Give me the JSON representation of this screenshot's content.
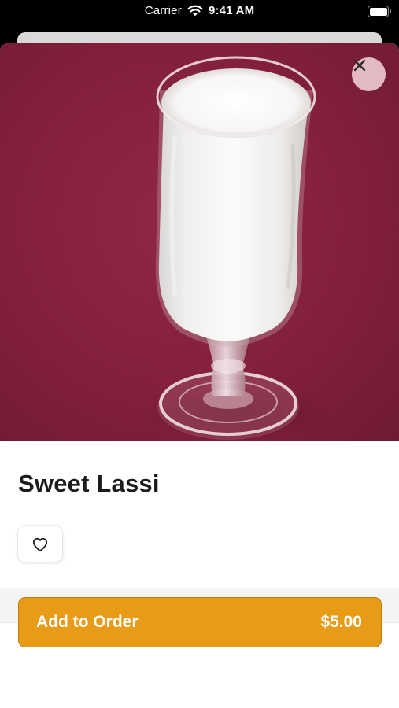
{
  "status_bar": {
    "carrier": "Carrier",
    "time": "9:41 AM"
  },
  "item": {
    "name": "Sweet Lassi",
    "image_icon": "sweet-lassi-photo",
    "hero_background_color": "#83203c"
  },
  "actions": {
    "close_icon": "close-icon",
    "favorite_icon": "heart-outline-icon",
    "add_to_order_label": "Add to Order",
    "price": "$5.00",
    "accent_color": "#e89b17"
  }
}
